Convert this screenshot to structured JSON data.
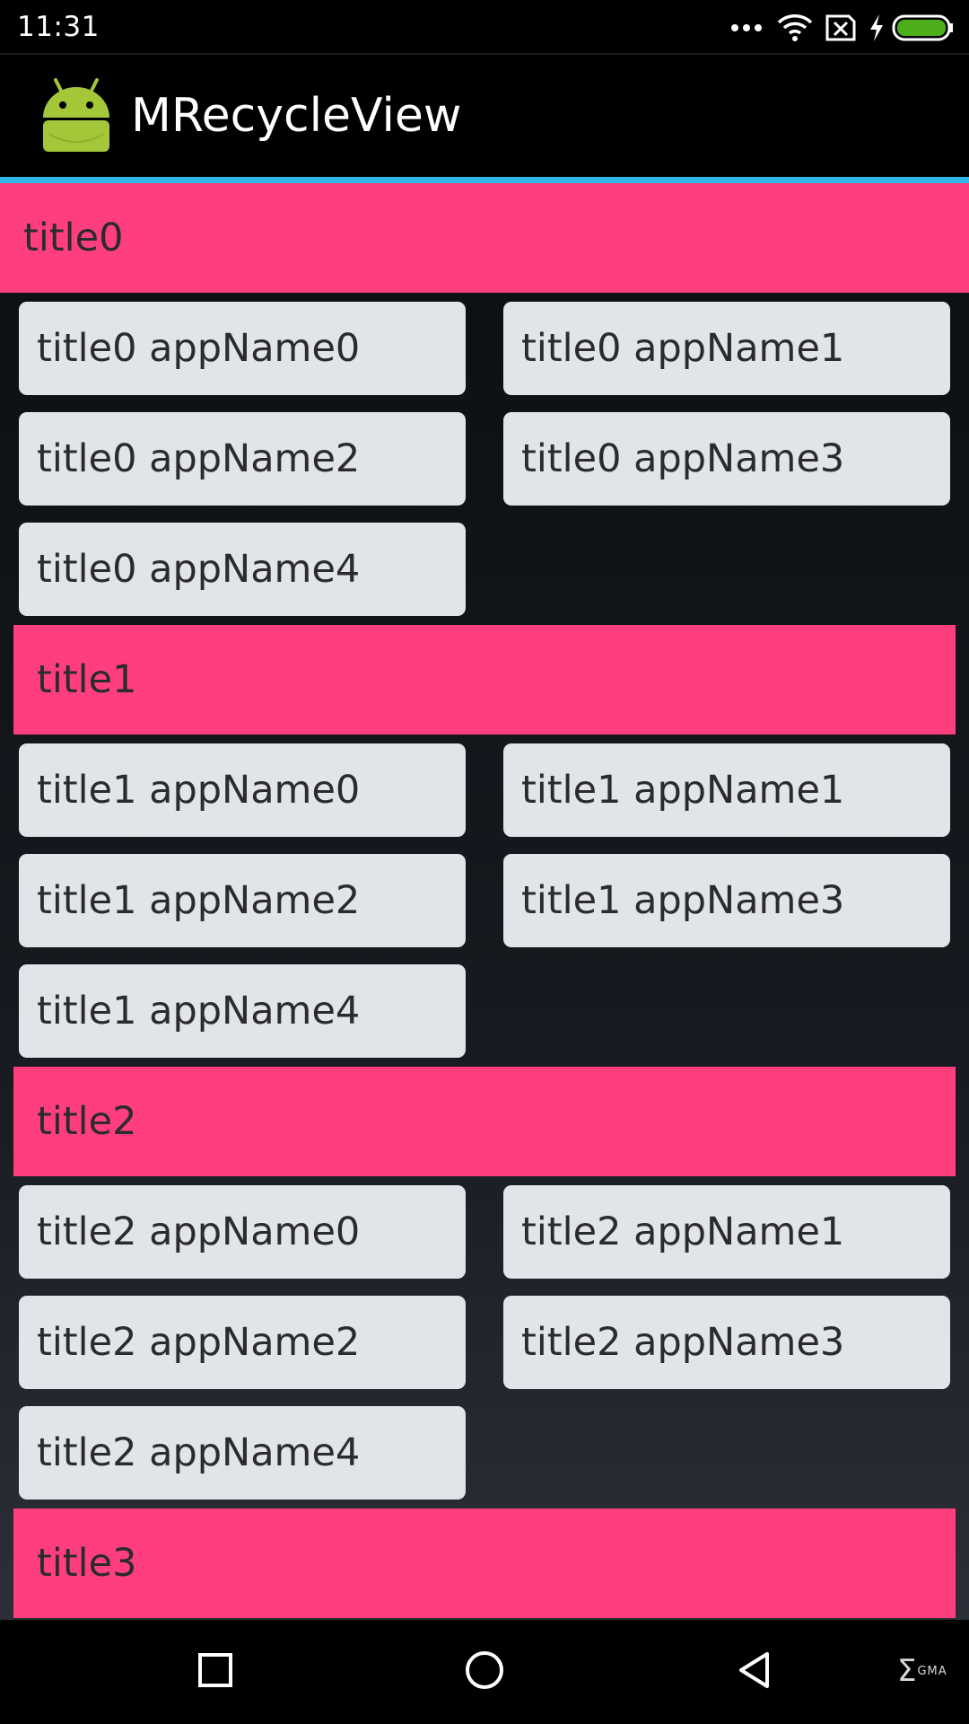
{
  "status_bar": {
    "time": "11:31",
    "icons": [
      "more-dots-icon",
      "wifi-icon",
      "no-sim-icon",
      "charging-bolt-icon",
      "battery-icon"
    ],
    "battery_color": "#4caf1a"
  },
  "action_bar": {
    "title": "MRecycleView",
    "logo_icon": "android-robot-icon",
    "accent_color": "#33b5e5"
  },
  "colors": {
    "header_bg": "#ff3f7d",
    "card_bg": "#e1e4e8"
  },
  "sections": [
    {
      "title": "title0",
      "items": [
        "title0 appName0",
        "title0 appName1",
        "title0 appName2",
        "title0 appName3",
        "title0 appName4"
      ]
    },
    {
      "title": "title1",
      "items": [
        "title1 appName0",
        "title1 appName1",
        "title1 appName2",
        "title1 appName3",
        "title1 appName4"
      ]
    },
    {
      "title": "title2",
      "items": [
        "title2 appName0",
        "title2 appName1",
        "title2 appName2",
        "title2 appName3",
        "title2 appName4"
      ]
    },
    {
      "title": "title3",
      "items": []
    }
  ],
  "nav_bar": {
    "buttons": [
      "recent-apps-icon",
      "home-icon",
      "back-icon"
    ],
    "watermark_text": "GMA"
  }
}
